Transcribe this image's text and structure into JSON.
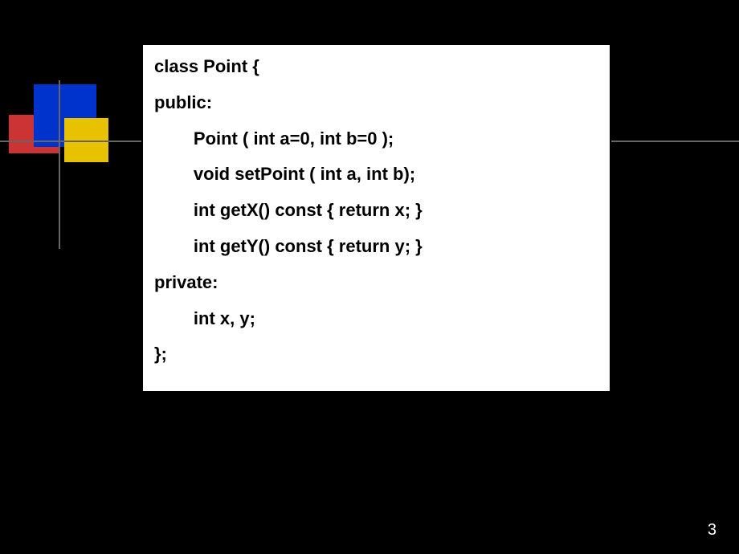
{
  "code": {
    "line1": "class Point {",
    "line2": "public:",
    "line3": "        Point ( int a=0, int b=0 );",
    "line4": "        void setPoint ( int a, int b);",
    "line5": "        int getX() const { return x; }",
    "line6": "        int getY() const { return y; }",
    "line7": "private:",
    "line8": "        int x, y;",
    "line9": "};"
  },
  "pageNumber": "3"
}
